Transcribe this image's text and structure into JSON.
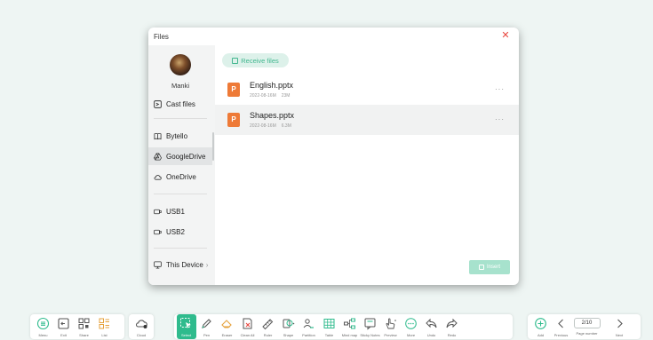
{
  "dialog": {
    "title": "Files",
    "close_icon": "close-icon",
    "user": {
      "name": "Manki"
    },
    "sidebar": {
      "cast_files": "Cast files",
      "items": [
        {
          "label": "Bytello",
          "icon": "book-icon"
        },
        {
          "label": "GoogleDrive",
          "icon": "google-drive-icon",
          "active": true
        },
        {
          "label": "OneDrive",
          "icon": "cloud-icon"
        },
        {
          "label": "USB1",
          "icon": "usb-icon"
        },
        {
          "label": "USB2",
          "icon": "usb-icon"
        },
        {
          "label": "This Device",
          "icon": "monitor-icon"
        }
      ],
      "chevron": "›"
    },
    "receive_files": "Receive files",
    "files": [
      {
        "name": "English.pptx",
        "date": "2022-08-16M",
        "size": "23M",
        "icon_letter": "P",
        "more": "···"
      },
      {
        "name": "Shapes.pptx",
        "date": "2022-08-16M",
        "size": "6.3M",
        "icon_letter": "P",
        "more": "···"
      }
    ],
    "insert": "Insert"
  },
  "toolbar": {
    "left": [
      "Menu",
      "Exit",
      "Share",
      "List"
    ],
    "cloud": "Cloud",
    "tools": [
      "Select",
      "Pen",
      "Eraser",
      "Clean All",
      "Ruler",
      "Shape",
      "Partition",
      "Table",
      "Mind map",
      "Sticky Notes",
      "Preview",
      "More",
      "Undo",
      "Redo"
    ],
    "right": {
      "add": "Add",
      "previous": "Previous",
      "page_number": "2/10",
      "page_label": "Page number",
      "next": "Next"
    }
  },
  "colors": {
    "accent": "#2fbb8d",
    "close": "#e8473f",
    "ppt": "#ee7a37"
  }
}
